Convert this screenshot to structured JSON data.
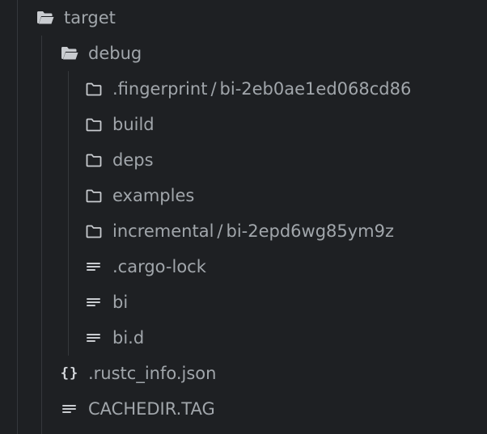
{
  "tree": {
    "root": {
      "label": "target",
      "icon": "folder-open-icon"
    },
    "debug": {
      "label": "debug",
      "icon": "folder-open-icon",
      "children": [
        {
          "label": ".fingerprint",
          "sub": "bi-2eb0ae1ed068cd86",
          "icon": "folder-icon"
        },
        {
          "label": "build",
          "icon": "folder-icon"
        },
        {
          "label": "deps",
          "icon": "folder-icon"
        },
        {
          "label": "examples",
          "icon": "folder-icon"
        },
        {
          "label": "incremental",
          "sub": "bi-2epd6wg85ym9z",
          "icon": "folder-icon"
        },
        {
          "label": ".cargo-lock",
          "icon": "file-text-icon"
        },
        {
          "label": "bi",
          "icon": "file-text-icon"
        },
        {
          "label": "bi.d",
          "icon": "file-text-icon"
        }
      ]
    },
    "rustc_info": {
      "label": ".rustc_info.json",
      "icon": "braces-icon",
      "glyph": "{}"
    },
    "cachedir": {
      "label": "CACHEDIR.TAG",
      "icon": "file-text-icon"
    },
    "separator": "/"
  },
  "colors": {
    "background": "#1e2023",
    "text": "#a1a6ab",
    "icon": "#d4d7db",
    "guide": "#35383c"
  }
}
